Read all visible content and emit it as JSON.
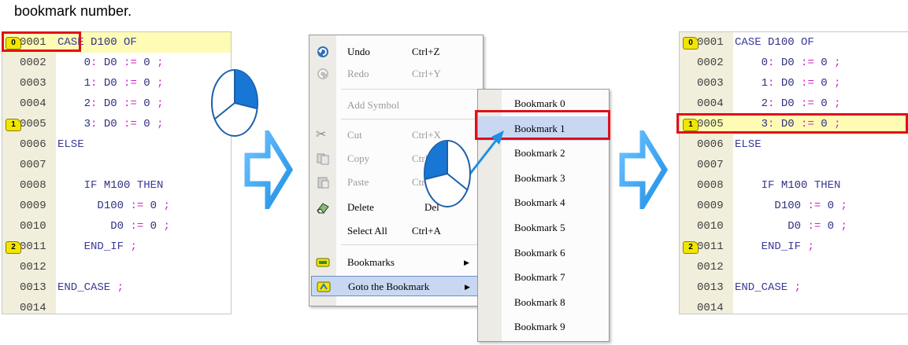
{
  "caption": "bookmark number.",
  "left_panel": {
    "lines": [
      {
        "num": "0001",
        "code": "CASE D100 OF",
        "bookmark": "0"
      },
      {
        "num": "0002",
        "code": "    0: D0 := 0 ;"
      },
      {
        "num": "0003",
        "code": "    1: D0 := 0 ;"
      },
      {
        "num": "0004",
        "code": "    2: D0 := 0 ;"
      },
      {
        "num": "0005",
        "code": "    3: D0 := 0 ;",
        "bookmark": "1"
      },
      {
        "num": "0006",
        "code": "ELSE"
      },
      {
        "num": "0007",
        "code": ""
      },
      {
        "num": "0008",
        "code": "    IF M100 THEN"
      },
      {
        "num": "0009",
        "code": "      D100 := 0 ;"
      },
      {
        "num": "0010",
        "code": "        D0 := 0 ;"
      },
      {
        "num": "0011",
        "code": "    END_IF ;",
        "bookmark": "2"
      },
      {
        "num": "0012",
        "code": ""
      },
      {
        "num": "0013",
        "code": "END_CASE ;"
      },
      {
        "num": "0014",
        "code": ""
      }
    ]
  },
  "right_panel": {
    "lines": [
      {
        "num": "0001",
        "code": "CASE D100 OF",
        "bookmark": "0"
      },
      {
        "num": "0002",
        "code": "    0: D0 := 0 ;"
      },
      {
        "num": "0003",
        "code": "    1: D0 := 0 ;"
      },
      {
        "num": "0004",
        "code": "    2: D0 := 0 ;"
      },
      {
        "num": "0005",
        "code": "    3: D0 := 0 ;",
        "bookmark": "1"
      },
      {
        "num": "0006",
        "code": "ELSE"
      },
      {
        "num": "0007",
        "code": ""
      },
      {
        "num": "0008",
        "code": "    IF M100 THEN"
      },
      {
        "num": "0009",
        "code": "      D100 := 0 ;"
      },
      {
        "num": "0010",
        "code": "        D0 := 0 ;"
      },
      {
        "num": "0011",
        "code": "    END_IF ;",
        "bookmark": "2"
      },
      {
        "num": "0012",
        "code": ""
      },
      {
        "num": "0013",
        "code": "END_CASE ;"
      },
      {
        "num": "0014",
        "code": ""
      }
    ]
  },
  "menu": {
    "undo": {
      "label": "Undo",
      "shortcut": "Ctrl+Z",
      "icon": "undo-icon"
    },
    "redo": {
      "label": "Redo",
      "shortcut": "Ctrl+Y",
      "icon": "redo-icon"
    },
    "add_symbol": {
      "label": "Add Symbol"
    },
    "cut": {
      "label": "Cut",
      "shortcut": "Ctrl+X",
      "icon": "scissors-icon"
    },
    "copy": {
      "label": "Copy",
      "shortcut": "Ctrl+C",
      "icon": "copy-icon"
    },
    "paste": {
      "label": "Paste",
      "shortcut": "Ctrl+V",
      "icon": "paste-icon"
    },
    "delete": {
      "label": "Delete",
      "shortcut": "Del",
      "icon": "eraser-icon"
    },
    "select_all": {
      "label": "Select All",
      "shortcut": "Ctrl+A"
    },
    "bookmarks": {
      "label": "Bookmarks",
      "icon": "bookmark-icon"
    },
    "goto_bookmark": {
      "label": "Goto the Bookmark",
      "icon": "goto-bookmark-icon"
    }
  },
  "submenu": {
    "items": [
      "Bookmark 0",
      "Bookmark 1",
      "Bookmark 2",
      "Bookmark 3",
      "Bookmark 4",
      "Bookmark 5",
      "Bookmark 6",
      "Bookmark 7",
      "Bookmark 8",
      "Bookmark 9"
    ],
    "selected_index": 1
  },
  "colors": {
    "highlight_line": "#fdfbb4",
    "bookmark_badge": "#f2e600",
    "red_frame": "#e0101a",
    "arrow_blue": "#1f8fe6",
    "menu_selection": "#c9d8f2"
  }
}
